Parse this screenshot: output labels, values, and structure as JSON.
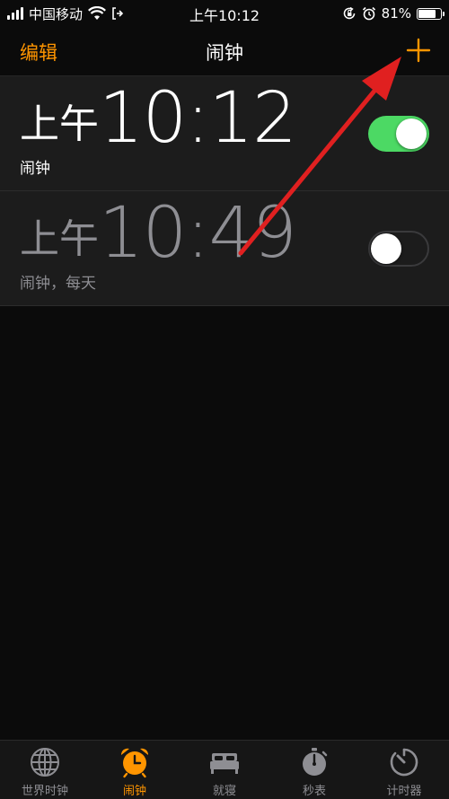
{
  "status_bar": {
    "carrier": "中国移动",
    "time": "上午10:12",
    "battery_text": "81%",
    "battery_level": 0.81
  },
  "nav": {
    "edit_label": "编辑",
    "title": "闹钟",
    "add_icon": "plus-icon"
  },
  "alarms": [
    {
      "period": "上午",
      "time": "10:12",
      "label": "闹钟",
      "enabled": true
    },
    {
      "period": "上午",
      "time": "10:49",
      "label": "闹钟，每天",
      "enabled": false
    }
  ],
  "tabs": [
    {
      "label": "世界时钟",
      "icon": "globe-icon",
      "active": false
    },
    {
      "label": "闹钟",
      "icon": "alarm-clock-icon",
      "active": true
    },
    {
      "label": "就寝",
      "icon": "bed-icon",
      "active": false
    },
    {
      "label": "秒表",
      "icon": "stopwatch-icon",
      "active": false
    },
    {
      "label": "计时器",
      "icon": "timer-icon",
      "active": false
    }
  ],
  "colors": {
    "accent": "#ff9500",
    "toggle_on": "#4cd964",
    "annotation": "#e02020"
  }
}
